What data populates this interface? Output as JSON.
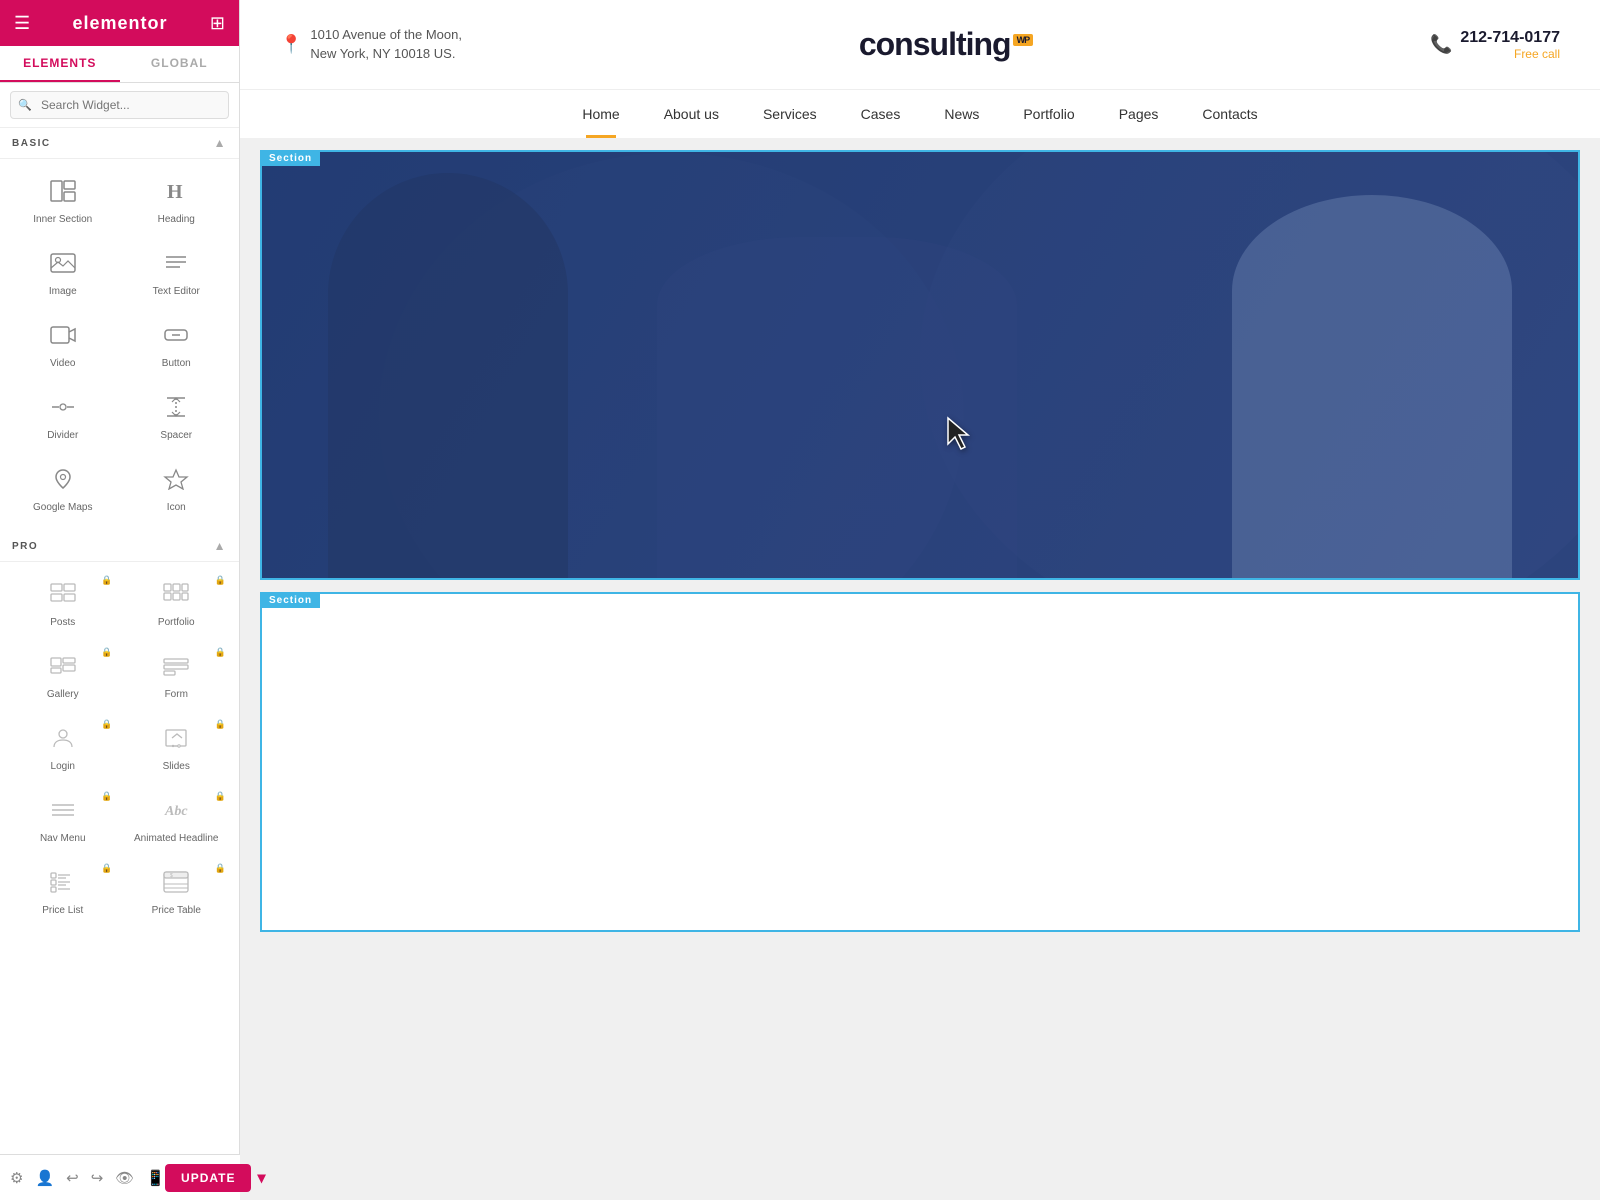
{
  "panel": {
    "logo": "elementor",
    "tabs": [
      {
        "id": "elements",
        "label": "ELEMENTS",
        "active": true
      },
      {
        "id": "global",
        "label": "GLOBAL",
        "active": false
      }
    ],
    "search": {
      "placeholder": "Search Widget..."
    },
    "sections": [
      {
        "id": "basic",
        "label": "BASIC",
        "widgets": [
          {
            "id": "inner-section",
            "label": "Inner Section",
            "icon": "inner-section-icon",
            "pro": false
          },
          {
            "id": "heading",
            "label": "Heading",
            "icon": "heading-icon",
            "pro": false
          },
          {
            "id": "image",
            "label": "Image",
            "icon": "image-icon",
            "pro": false
          },
          {
            "id": "text-editor",
            "label": "Text Editor",
            "icon": "text-editor-icon",
            "pro": false
          },
          {
            "id": "video",
            "label": "Video",
            "icon": "video-icon",
            "pro": false
          },
          {
            "id": "button",
            "label": "Button",
            "icon": "button-icon",
            "pro": false
          },
          {
            "id": "divider",
            "label": "Divider",
            "icon": "divider-icon",
            "pro": false
          },
          {
            "id": "spacer",
            "label": "Spacer",
            "icon": "spacer-icon",
            "pro": false
          },
          {
            "id": "google-maps",
            "label": "Google Maps",
            "icon": "google-maps-icon",
            "pro": false
          },
          {
            "id": "icon",
            "label": "Icon",
            "icon": "icon-widget-icon",
            "pro": false
          }
        ]
      },
      {
        "id": "pro",
        "label": "PRO",
        "widgets": [
          {
            "id": "posts",
            "label": "Posts",
            "icon": "posts-icon",
            "pro": true
          },
          {
            "id": "portfolio",
            "label": "Portfolio",
            "icon": "portfolio-icon",
            "pro": true
          },
          {
            "id": "gallery",
            "label": "Gallery",
            "icon": "gallery-icon",
            "pro": true
          },
          {
            "id": "form",
            "label": "Form",
            "icon": "form-icon",
            "pro": true
          },
          {
            "id": "login",
            "label": "Login",
            "icon": "login-icon",
            "pro": true
          },
          {
            "id": "slides",
            "label": "Slides",
            "icon": "slides-icon",
            "pro": true
          },
          {
            "id": "nav-menu",
            "label": "Nav Menu",
            "icon": "nav-menu-icon",
            "pro": true
          },
          {
            "id": "animated-headline",
            "label": "Animated Headline",
            "icon": "animated-headline-icon",
            "pro": true
          },
          {
            "id": "price-list",
            "label": "Price List",
            "icon": "price-list-icon",
            "pro": true
          },
          {
            "id": "price-table",
            "label": "Price Table",
            "icon": "price-table-icon",
            "pro": true
          }
        ]
      }
    ],
    "toolbar": {
      "update_label": "UPDATE"
    }
  },
  "site": {
    "address_line1": "1010 Avenue of the Moon,",
    "address_line2": "New York, NY 10018 US.",
    "logo": "consulting",
    "wp_badge": "WP",
    "phone": "212-714-0177",
    "phone_sub": "Free call",
    "nav_items": [
      {
        "id": "home",
        "label": "Home",
        "active": true
      },
      {
        "id": "about",
        "label": "About us",
        "active": false
      },
      {
        "id": "services",
        "label": "Services",
        "active": false
      },
      {
        "id": "cases",
        "label": "Cases",
        "active": false
      },
      {
        "id": "news",
        "label": "News",
        "active": false
      },
      {
        "id": "portfolio",
        "label": "Portfolio",
        "active": false
      },
      {
        "id": "pages",
        "label": "Pages",
        "active": false
      },
      {
        "id": "contacts",
        "label": "Contacts",
        "active": false
      }
    ]
  },
  "canvas": {
    "section_label": "Section",
    "empty_section_label": "Section"
  }
}
